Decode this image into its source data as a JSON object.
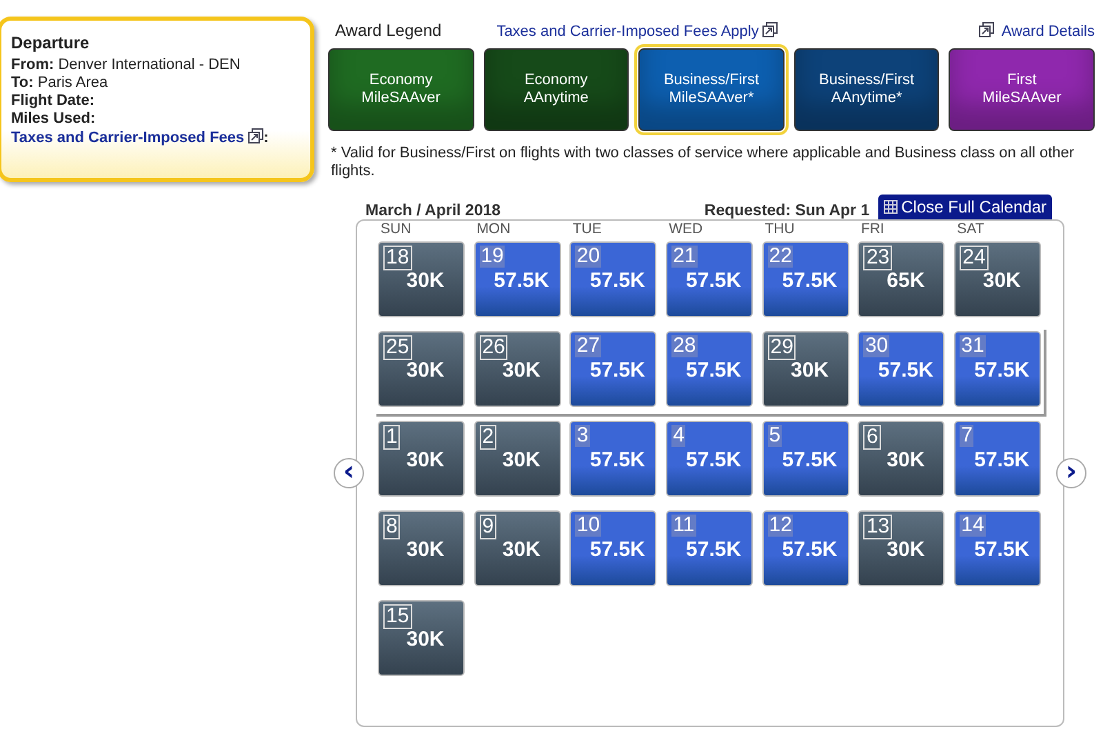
{
  "trip": {
    "heading": "Departure",
    "fields": [
      {
        "label": "From:",
        "value": "Denver International - DEN"
      },
      {
        "label": "To:",
        "value": "Paris Area"
      },
      {
        "label": "Flight Date:"
      },
      {
        "label": "Miles Used:"
      }
    ],
    "fees_link": "Taxes and Carrier-Imposed Fees",
    "fees_suffix": ":"
  },
  "legend": {
    "title": "Award Legend",
    "fees_link": "Taxes and Carrier-Imposed Fees Apply",
    "details_link": "Award Details",
    "items": [
      {
        "line1": "Economy",
        "line2": "MileSAAver",
        "color": "#1f6b22",
        "selected": false
      },
      {
        "line1": "Economy",
        "line2": "AAnytime",
        "color": "#164a19",
        "selected": false
      },
      {
        "line1": "Business/First",
        "line2": "MileSAAver*",
        "color": "#0d5fb0",
        "selected": true
      },
      {
        "line1": "Business/First",
        "line2": "AAnytime*",
        "color": "#0d4279",
        "selected": false
      },
      {
        "line1": "First",
        "line2": "MileSAAver",
        "color": "#8f28ad",
        "selected": false
      }
    ],
    "note": "* Valid for Business/First on flights with two classes of service where applicable and Business class on all other flights."
  },
  "calendar": {
    "title": "March / April 2018",
    "requested": "Requested: Sun Apr 1",
    "close_button": "Close Full Calendar",
    "prev": "‹",
    "next": "›",
    "weekdays": [
      "SUN",
      "MON",
      "TUE",
      "WED",
      "THU",
      "FRI",
      "SAT"
    ],
    "weeks": [
      {
        "highlighted": false,
        "days": [
          {
            "day": "18",
            "miles": "30K",
            "kind": "gray"
          },
          {
            "day": "19",
            "miles": "57.5K",
            "kind": "blue"
          },
          {
            "day": "20",
            "miles": "57.5K",
            "kind": "blue"
          },
          {
            "day": "21",
            "miles": "57.5K",
            "kind": "blue"
          },
          {
            "day": "22",
            "miles": "57.5K",
            "kind": "blue"
          },
          {
            "day": "23",
            "miles": "65K",
            "kind": "gray"
          },
          {
            "day": "24",
            "miles": "30K",
            "kind": "gray"
          }
        ]
      },
      {
        "highlighted": true,
        "days": [
          {
            "day": "25",
            "miles": "30K",
            "kind": "gray"
          },
          {
            "day": "26",
            "miles": "30K",
            "kind": "gray"
          },
          {
            "day": "27",
            "miles": "57.5K",
            "kind": "blue"
          },
          {
            "day": "28",
            "miles": "57.5K",
            "kind": "blue"
          },
          {
            "day": "29",
            "miles": "30K",
            "kind": "gray"
          },
          {
            "day": "30",
            "miles": "57.5K",
            "kind": "blue"
          },
          {
            "day": "31",
            "miles": "57.5K",
            "kind": "blue"
          }
        ]
      },
      {
        "highlighted": false,
        "days": [
          {
            "day": "1",
            "miles": "30K",
            "kind": "gray"
          },
          {
            "day": "2",
            "miles": "30K",
            "kind": "gray"
          },
          {
            "day": "3",
            "miles": "57.5K",
            "kind": "blue"
          },
          {
            "day": "4",
            "miles": "57.5K",
            "kind": "blue"
          },
          {
            "day": "5",
            "miles": "57.5K",
            "kind": "blue"
          },
          {
            "day": "6",
            "miles": "30K",
            "kind": "gray"
          },
          {
            "day": "7",
            "miles": "57.5K",
            "kind": "blue"
          }
        ]
      },
      {
        "highlighted": false,
        "days": [
          {
            "day": "8",
            "miles": "30K",
            "kind": "gray"
          },
          {
            "day": "9",
            "miles": "30K",
            "kind": "gray"
          },
          {
            "day": "10",
            "miles": "57.5K",
            "kind": "blue"
          },
          {
            "day": "11",
            "miles": "57.5K",
            "kind": "blue"
          },
          {
            "day": "12",
            "miles": "57.5K",
            "kind": "blue"
          },
          {
            "day": "13",
            "miles": "30K",
            "kind": "gray"
          },
          {
            "day": "14",
            "miles": "57.5K",
            "kind": "blue"
          }
        ]
      },
      {
        "highlighted": false,
        "days": [
          {
            "day": "15",
            "miles": "30K",
            "kind": "gray"
          }
        ]
      }
    ]
  }
}
